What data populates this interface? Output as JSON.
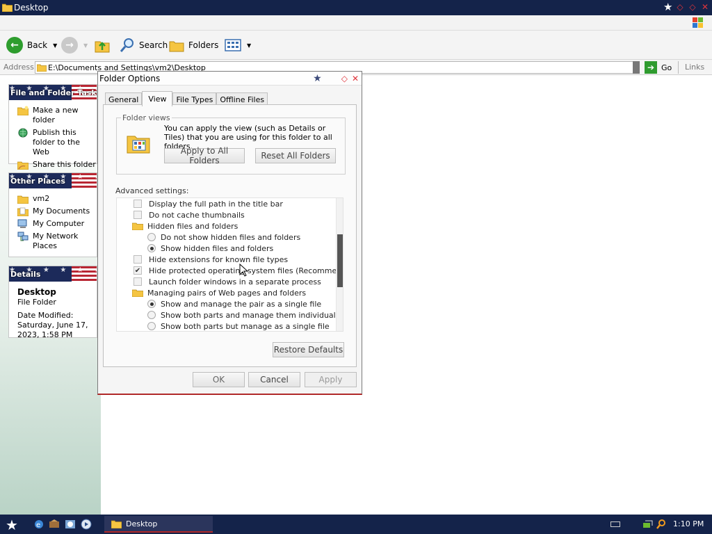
{
  "window": {
    "title": "Desktop"
  },
  "toolbar": {
    "back_label": "Back",
    "search_label": "Search",
    "folders_label": "Folders"
  },
  "address": {
    "label": "Address",
    "value": "E:\\Documents and Settings\\vm2\\Desktop",
    "go_label": "Go",
    "links_label": "Links"
  },
  "leftpane": {
    "tasks": {
      "title": "File and Folder Tasks",
      "items": [
        {
          "label": "Make a new folder",
          "icon": "new-folder-icon"
        },
        {
          "label": "Publish this folder to the Web",
          "icon": "globe-icon"
        },
        {
          "label": "Share this folder",
          "icon": "share-folder-icon"
        }
      ]
    },
    "places": {
      "title": "Other Places",
      "items": [
        {
          "label": "vm2",
          "icon": "folder-icon"
        },
        {
          "label": "My Documents",
          "icon": "my-documents-icon"
        },
        {
          "label": "My Computer",
          "icon": "my-computer-icon"
        },
        {
          "label": "My Network Places",
          "icon": "network-places-icon"
        }
      ]
    },
    "details": {
      "title": "Details",
      "name": "Desktop",
      "type": "File Folder",
      "modified": "Date Modified: Saturday, June 17, 2023, 1:58 PM"
    }
  },
  "dialog": {
    "title": "Folder Options",
    "tabs": [
      "General",
      "View",
      "File Types",
      "Offline Files"
    ],
    "active_tab": "View",
    "folder_views": {
      "legend": "Folder views",
      "description": "You can apply the view (such as Details or Tiles) that you are using for this folder to all folders.",
      "apply_all_label": "Apply to All Folders",
      "reset_all_label": "Reset All Folders"
    },
    "advanced_label": "Advanced settings:",
    "settings": [
      {
        "type": "checkbox",
        "label": "Display the full path in the title bar",
        "checked": false
      },
      {
        "type": "checkbox",
        "label": "Do not cache thumbnails",
        "checked": false
      },
      {
        "type": "folder",
        "label": "Hidden files and folders"
      },
      {
        "type": "radio",
        "label": "Do not show hidden files and folders",
        "checked": false
      },
      {
        "type": "radio",
        "label": "Show hidden files and folders",
        "checked": true
      },
      {
        "type": "checkbox",
        "label": "Hide extensions for known file types",
        "checked": false
      },
      {
        "type": "checkbox",
        "label": "Hide protected operating system files (Recommended)",
        "checked": true
      },
      {
        "type": "checkbox",
        "label": "Launch folder windows in a separate process",
        "checked": false
      },
      {
        "type": "folder",
        "label": "Managing pairs of Web pages and folders"
      },
      {
        "type": "radio",
        "label": "Show and manage the pair as a single file",
        "checked": true
      },
      {
        "type": "radio",
        "label": "Show both parts and manage them individually",
        "checked": false
      },
      {
        "type": "radio",
        "label": "Show both parts but manage as a single file",
        "checked": false
      }
    ],
    "restore_defaults_label": "Restore Defaults",
    "ok_label": "OK",
    "cancel_label": "Cancel",
    "apply_label": "Apply"
  },
  "taskbar": {
    "task_label": "Desktop",
    "clock": "1:10 PM"
  },
  "colors": {
    "titlebar": "#14234a",
    "accent_red": "#b02828",
    "go_green": "#2f9b2f"
  }
}
